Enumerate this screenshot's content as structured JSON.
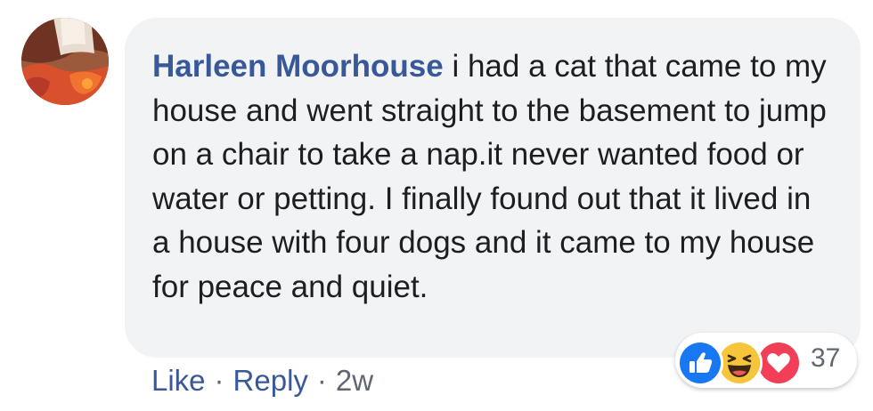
{
  "comment": {
    "author": "Harleen Moorhouse",
    "text": "i had a cat that came to my house and went straight to the basement to jump on a chair to take a nap.it never wanted food or water or petting. I finally found out that it lived in a house with four dogs and it came to my house for peace and quiet."
  },
  "actions": {
    "like_label": "Like",
    "separator": "·",
    "reply_label": "Reply",
    "timestamp": "2w"
  },
  "reactions": {
    "icons": [
      "like-icon",
      "haha-icon",
      "love-icon"
    ],
    "count": "37"
  },
  "colors": {
    "bubble_bg": "#f2f3f5",
    "author_link": "#385898",
    "body_text": "#1c1e21",
    "secondary_text": "#616770",
    "like_blue": "#1877f2",
    "haha_yellow": "#f7c53b",
    "love_red": "#f33e58"
  }
}
